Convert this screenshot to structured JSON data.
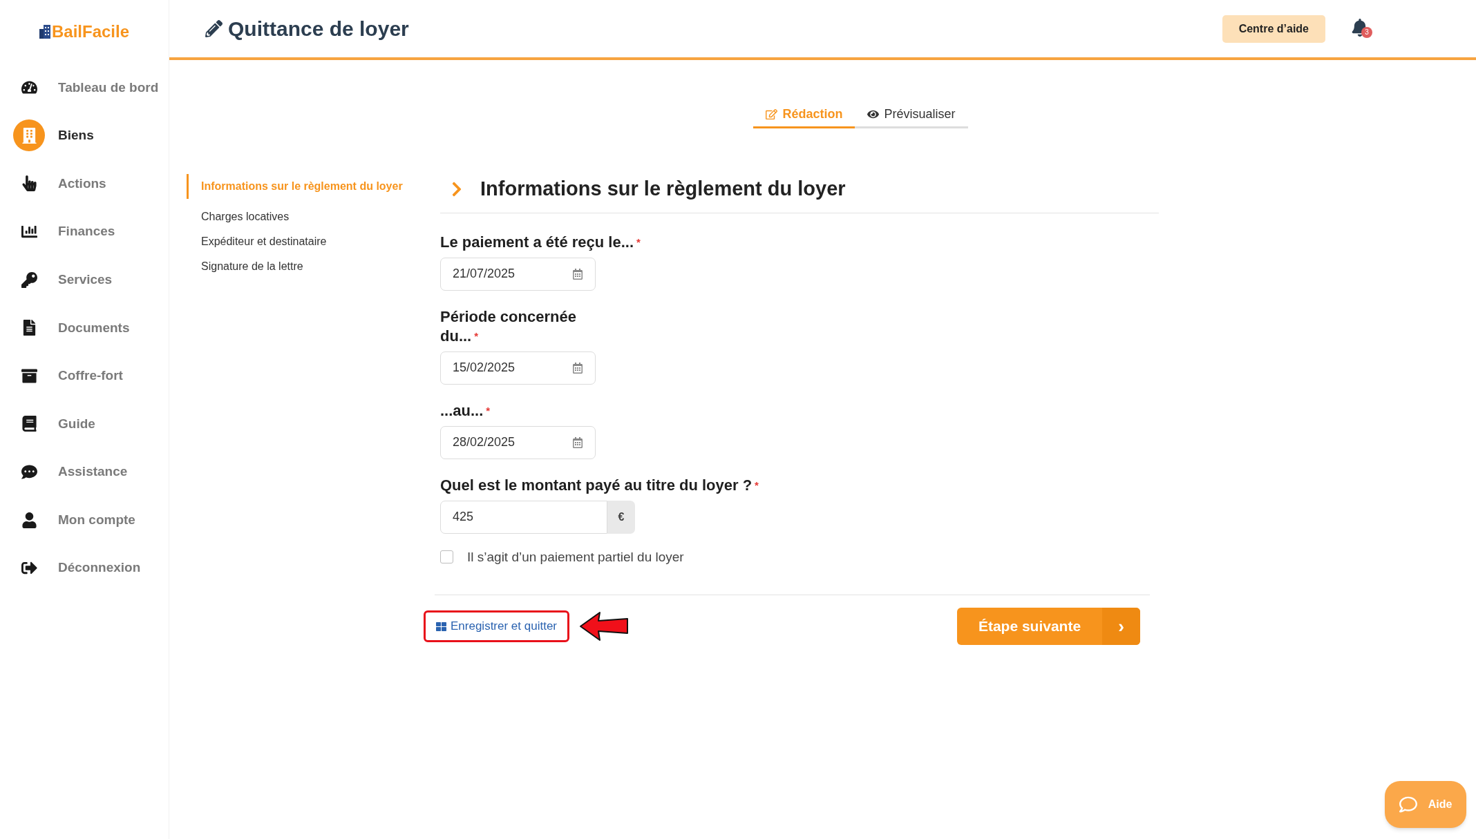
{
  "logo": "BailFacile",
  "sidebar": {
    "items": [
      {
        "label": "Tableau de bord",
        "selected": false
      },
      {
        "label": "Biens",
        "selected": true
      },
      {
        "label": "Actions",
        "selected": false
      },
      {
        "label": "Finances",
        "selected": false
      },
      {
        "label": "Services",
        "selected": false
      },
      {
        "label": "Documents",
        "selected": false
      },
      {
        "label": "Coffre-fort",
        "selected": false
      },
      {
        "label": "Guide",
        "selected": false
      },
      {
        "label": "Assistance",
        "selected": false
      },
      {
        "label": "Mon compte",
        "selected": false
      },
      {
        "label": "Déconnexion",
        "selected": false
      }
    ]
  },
  "header": {
    "title": "Quittance de loyer",
    "help_button": "Centre d’aide",
    "notification_count": "3"
  },
  "tabs": [
    {
      "label": "Rédaction",
      "selected": true
    },
    {
      "label": "Prévisualiser",
      "selected": false
    }
  ],
  "steps": [
    {
      "label": "Informations sur le règlement du loyer",
      "selected": true
    },
    {
      "label": "Charges locatives",
      "selected": false
    },
    {
      "label": "Expéditeur et destinataire",
      "selected": false
    },
    {
      "label": "Signature de la lettre",
      "selected": false
    }
  ],
  "section": {
    "title": "Informations sur le règlement du loyer"
  },
  "fields": [
    {
      "kind": "date",
      "label": "Le paiement a été reçu le...",
      "required_mark": "*",
      "value": "21/07/2025"
    },
    {
      "kind": "date",
      "label": "Période concernée du...",
      "required_mark": "*",
      "value": "15/02/2025"
    },
    {
      "kind": "date",
      "label": "...au...",
      "required_mark": "*",
      "value": "28/02/2025"
    },
    {
      "kind": "amount",
      "label": "Quel est le montant payé au titre du loyer ?",
      "required_mark": "*",
      "value": "425",
      "unit": "€"
    }
  ],
  "partial_payment": {
    "label": "Il s’agit d’un paiement partiel du loyer",
    "checked": false
  },
  "save_button": "Enregistrer et quitter",
  "next_button": {
    "label": "Étape suivante",
    "icon_text": "›"
  },
  "chat_button": "Aide"
}
